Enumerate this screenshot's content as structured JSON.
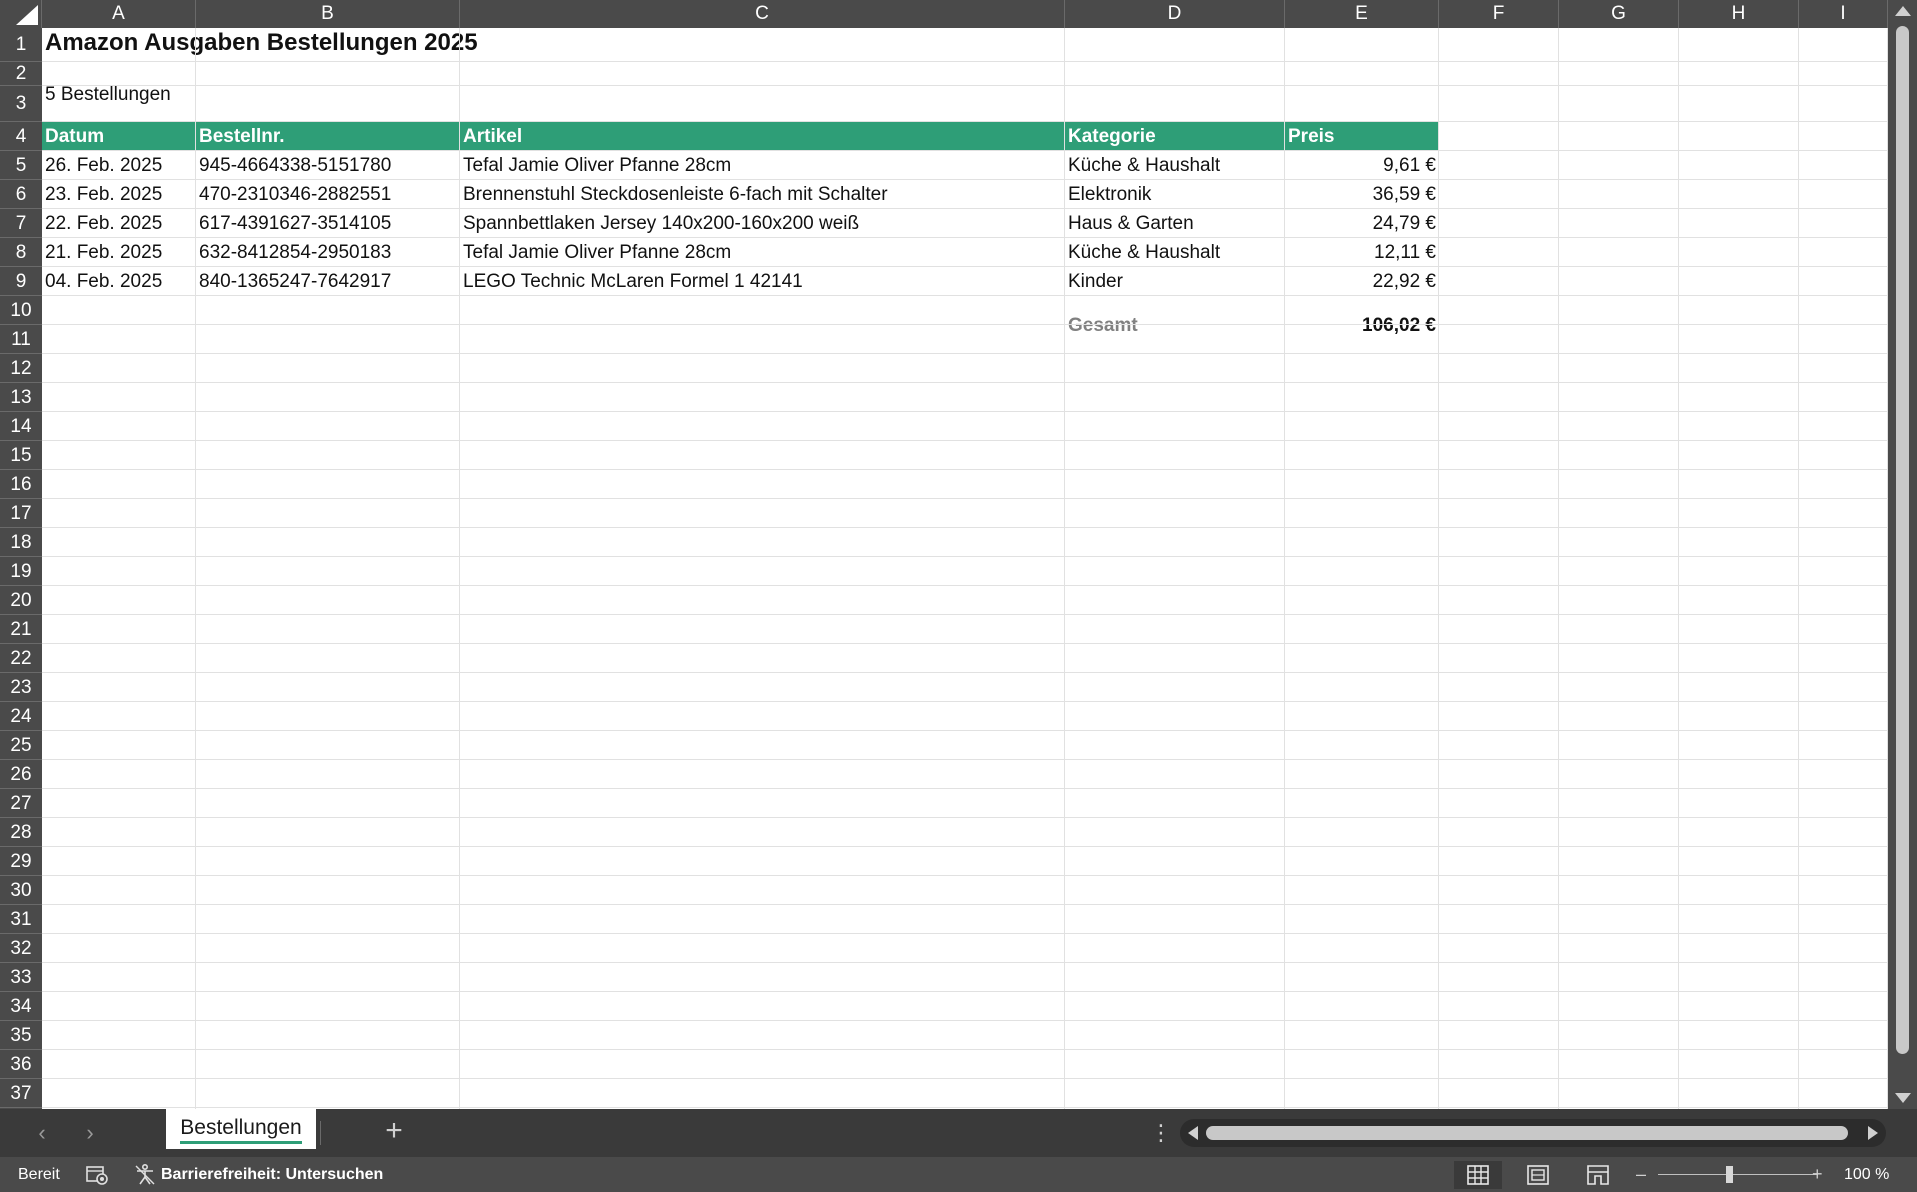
{
  "columns": [
    "A",
    "B",
    "C",
    "D",
    "E",
    "F",
    "G",
    "H",
    "I"
  ],
  "rows": [
    "1",
    "2",
    "3",
    "4",
    "5",
    "6",
    "7",
    "8",
    "9",
    "10",
    "11",
    "12",
    "13",
    "14",
    "15",
    "16",
    "17",
    "18",
    "19",
    "20",
    "21",
    "22",
    "23",
    "24",
    "25",
    "26",
    "27",
    "28",
    "29",
    "30",
    "31",
    "32",
    "33",
    "34",
    "35",
    "36",
    "37"
  ],
  "sheet": {
    "title": "Amazon Ausgaben Bestellungen 2025",
    "subtitle": "5 Bestellungen",
    "headers": [
      "Datum",
      "Bestellnr.",
      "Artikel",
      "Kategorie",
      "Preis"
    ],
    "orders": [
      {
        "datum": "26. Feb. 2025",
        "bestellnr": "945-4664338-5151780",
        "artikel": "Tefal Jamie Oliver Pfanne 28cm",
        "kategorie": "Küche & Haushalt",
        "preis": "9,61 €"
      },
      {
        "datum": "23. Feb. 2025",
        "bestellnr": "470-2310346-2882551",
        "artikel": "Brennenstuhl Steckdosenleiste 6-fach mit Schalter",
        "kategorie": "Elektronik",
        "preis": "36,59 €"
      },
      {
        "datum": "22. Feb. 2025",
        "bestellnr": "617-4391627-3514105",
        "artikel": "Spannbettlaken Jersey 140x200-160x200 weiß",
        "kategorie": "Haus & Garten",
        "preis": "24,79 €"
      },
      {
        "datum": "21. Feb. 2025",
        "bestellnr": "632-8412854-2950183",
        "artikel": "Tefal Jamie Oliver Pfanne 28cm",
        "kategorie": "Küche & Haushalt",
        "preis": "12,11 €"
      },
      {
        "datum": "04. Feb. 2025",
        "bestellnr": "840-1365247-7642917",
        "artikel": "LEGO Technic McLaren Formel 1 42141",
        "kategorie": "Kinder",
        "preis": "22,92 €"
      }
    ],
    "total_label": "Gesamt",
    "total_value": "106,02 €"
  },
  "tabs": {
    "active_sheet": "Bestellungen",
    "add_symbol": "+",
    "prev_symbol": "‹",
    "next_symbol": "›",
    "more_symbol": "⋮"
  },
  "status": {
    "ready": "Bereit",
    "accessibility": "Barrierefreiheit: Untersuchen",
    "zoom_minus": "–",
    "zoom_plus": "+",
    "zoom_level": "100 %"
  },
  "icons": {
    "macro": "macro-record-icon",
    "accessibility": "accessibility-icon",
    "view_normal": "normal-view-icon",
    "view_layout": "page-layout-icon",
    "view_break": "page-break-icon"
  },
  "colors": {
    "header_band": "#2e9e77",
    "chrome_dark": "#4a4a4a",
    "tab_bar": "#3a3a3a",
    "gridline": "#e1e1e1"
  }
}
